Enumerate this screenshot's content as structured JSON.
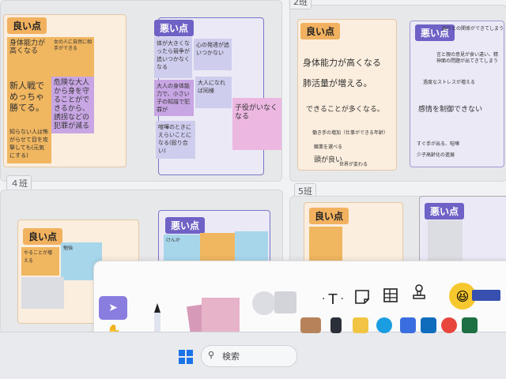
{
  "groups": {
    "g5_label": "5班",
    "g4_label": "４班",
    "top_right_label": "2班"
  },
  "tags": {
    "good": "良い点",
    "bad": "悪い点"
  },
  "panel1_good_notes": {
    "n1": "身体能力が高くなる",
    "n2": "女の人に自然に相手ができる",
    "n3": "新人戦でめっちゃ勝てる。",
    "n4": "危険な大人から身を守ることができるから、誘拐などの犯罪が減る",
    "n5": "知らない人は怖がらせて目を攻撃しても(元気にする)"
  },
  "panel1_bad_notes": {
    "n1": "体が大きくなったら競争が追いつかなくなる",
    "n2": "心の発達が追いつかない",
    "n3": "大人の身体能力で、小さい子の知識で犯罪が",
    "n4": "大人になれば同様",
    "n5": "喧嘩のときにえらいことになる(殴り合い)",
    "n6": "子役がいなくなる"
  },
  "panel2_good_texts": {
    "t1": "身体能力が高くなる",
    "t2": "肺活量が増える。",
    "t3": "できることが多くなる。",
    "t4": "働き手の増加（仕事ができる年齢）",
    "t5": "職業を選べる",
    "t6": "頭が良い",
    "t7": "世界が変わる"
  },
  "panel2_bad_texts": {
    "t1": "周りとの関係ができてしまう",
    "t2": "言と親の意見が食い違い、精神面の問題が出てきてしまう",
    "t3": "過度なストレスが増える",
    "t4": "感情を制御できない",
    "t5": "すぐ手が出る、喧嘩",
    "t6": "少子高齢化の進展"
  },
  "row2_notes": {
    "a1": "やることが増える",
    "a2": "勉強",
    "b1": "けんか"
  },
  "toolbar": {
    "text_tool": "T",
    "dot": "·"
  },
  "taskbar": {
    "search_placeholder": "検索"
  },
  "colors": {
    "good_tag": "#f2b15f",
    "bad_tag": "#6e62c6",
    "pointer_tool": "#8a7de0"
  },
  "icons": {
    "pointer": "pointer-icon",
    "hand": "hand-icon",
    "pen": "pen-icon",
    "text": "text-icon",
    "sticky": "sticky-note-icon",
    "table": "table-icon",
    "stamp": "stamp-icon",
    "emoji": "laughing-emoji-icon",
    "windows": "windows-start-icon",
    "search": "search-icon"
  }
}
